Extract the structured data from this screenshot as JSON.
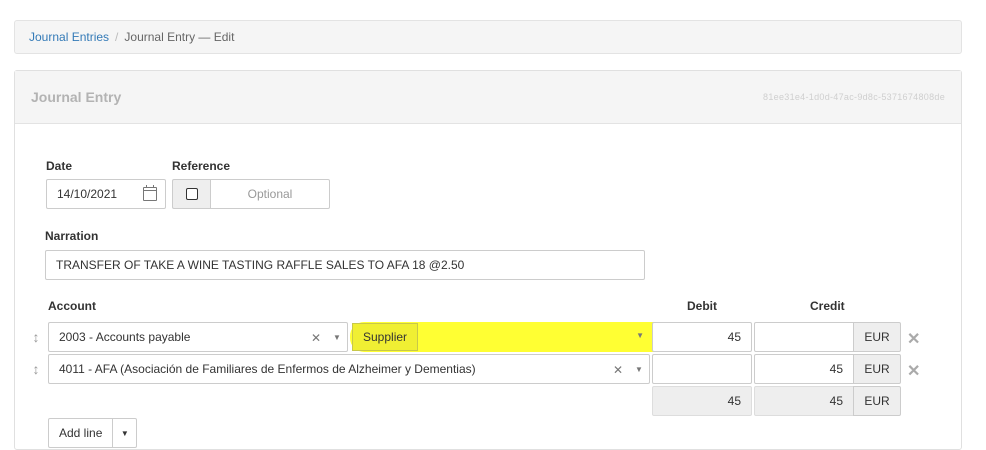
{
  "breadcrumb": {
    "link": "Journal Entries",
    "separator": "/",
    "current": "Journal Entry — Edit"
  },
  "panel": {
    "title": "Journal Entry",
    "id": "81ee31e4-1d0d-47ac-9d8c-5371674808de"
  },
  "form": {
    "date_label": "Date",
    "date_value": "14/10/2021",
    "reference_label": "Reference",
    "reference_placeholder": "Optional",
    "narration_label": "Narration",
    "narration_value": "TRANSFER OF TAKE A WINE TASTING RAFFLE SALES TO AFA 18 @2.50"
  },
  "lines": {
    "headers": {
      "account": "Account",
      "debit": "Debit",
      "credit": "Credit"
    },
    "rows": [
      {
        "account": "2003 - Accounts payable",
        "party_label": "Supplier",
        "party_value": "",
        "debit": "45",
        "credit": "",
        "currency": "EUR"
      },
      {
        "account": "4011 - AFA (Asociación de Familiares de Enfermos de Alzheimer y Dementias)",
        "debit": "",
        "credit": "45",
        "currency": "EUR"
      }
    ],
    "totals": {
      "debit": "45",
      "credit": "45",
      "currency": "EUR"
    }
  },
  "actions": {
    "add_line": "Add line"
  },
  "icons": {
    "calendar": "calendar-icon",
    "drag": "drag-handle-icon",
    "clear": "clear-icon",
    "dropdown": "chevron-down-icon",
    "remove": "remove-line-icon"
  },
  "colors": {
    "highlight": "#ffff33",
    "link": "#337ab7"
  }
}
